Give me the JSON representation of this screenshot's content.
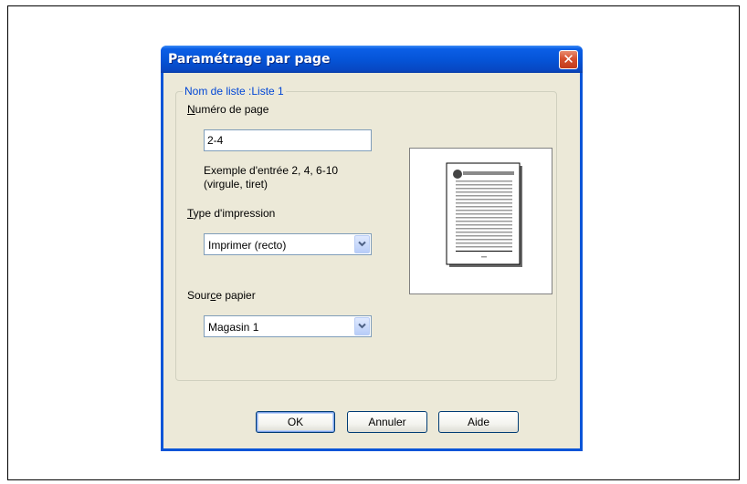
{
  "dialog": {
    "title": "Paramétrage par page",
    "close_glyph": "✕"
  },
  "group": {
    "legend": "Nom de liste :Liste 1"
  },
  "page_number": {
    "label_mnemonic": "N",
    "label_rest": "uméro de page",
    "value": "2-4",
    "example_line1": "Exemple d'entrée 2, 4, 6-10",
    "example_line2": "(virgule, tiret)"
  },
  "print_type": {
    "label_mnemonic": "T",
    "label_rest": "ype d'impression",
    "selected": "Imprimer (recto)"
  },
  "paper_source": {
    "label_before": "Sour",
    "label_mnemonic": "c",
    "label_after": "e papier",
    "selected": "Magasin 1"
  },
  "buttons": {
    "ok": "OK",
    "cancel": "Annuler",
    "help": "Aide"
  },
  "icons": {
    "close": "close-icon",
    "dropdown": "chevron-down-icon",
    "preview": "page-preview-icon"
  },
  "colors": {
    "title_bar": "#0553d6",
    "dialog_face": "#ece9d8",
    "legend_text": "#0046d5",
    "close_button": "#d6502f",
    "input_border": "#7f9db9"
  }
}
